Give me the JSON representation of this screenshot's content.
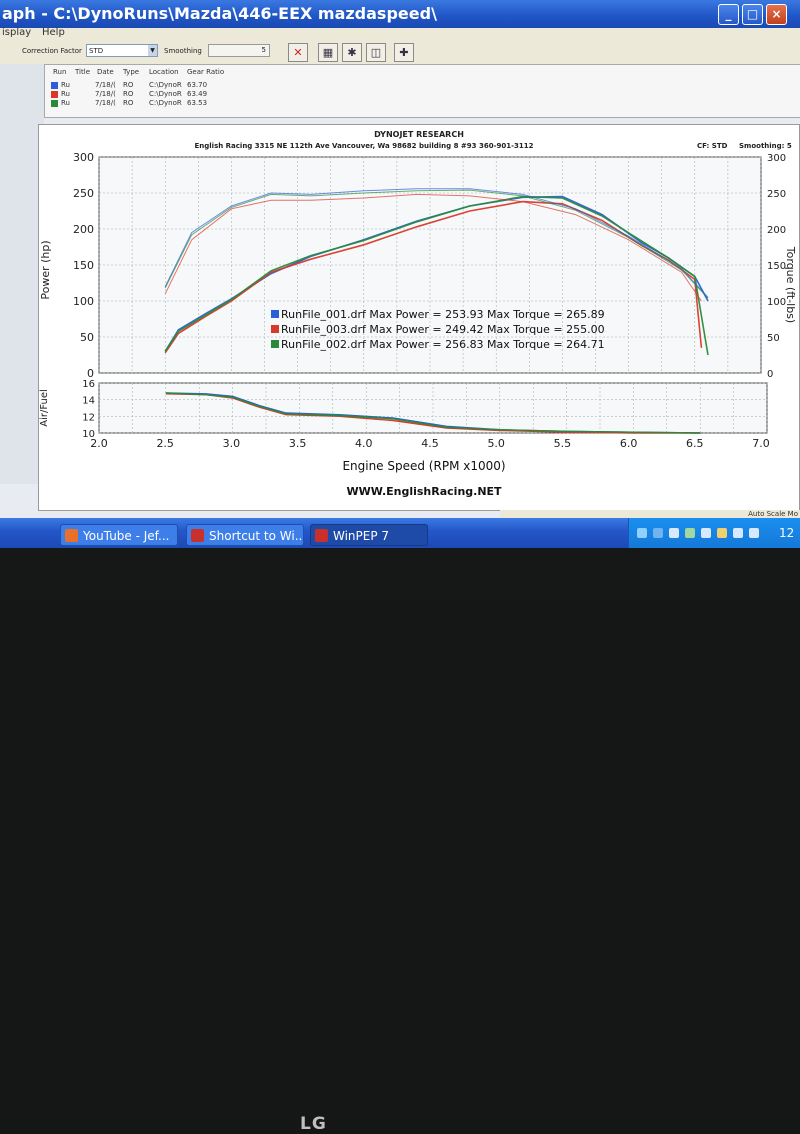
{
  "window": {
    "title": "aph - C:\\DynoRuns\\Mazda\\446-EEX mazdaspeed\\",
    "min_icon": "minimize-icon",
    "max_icon": "maximize-icon",
    "close_icon": "close-icon"
  },
  "menu": {
    "items": [
      "isplay",
      "Help"
    ]
  },
  "toolbar": {
    "correction_label": "Correction Factor",
    "correction_value": "STD",
    "smoothing_label": "Smoothing",
    "smoothing_value": "5",
    "icons": [
      "close-x-icon",
      "grid-icon",
      "settings-icon",
      "graph-icon",
      "crosshair-icon"
    ]
  },
  "run_list": {
    "columns": [
      "Run",
      "Title",
      "Date",
      "Type",
      "Location",
      "Gear Ratio"
    ],
    "rows": [
      {
        "color": "#2a5fd8",
        "run": "Ru",
        "date": "7/18/(",
        "type": "RO",
        "location": "C:\\DynoR",
        "gear_ratio": "63.70"
      },
      {
        "color": "#d83a2a",
        "run": "Ru",
        "date": "7/18/(",
        "type": "RO",
        "location": "C:\\DynoR",
        "gear_ratio": "63.49"
      },
      {
        "color": "#2a8a3a",
        "run": "Ru",
        "date": "7/18/(",
        "type": "RO",
        "location": "C:\\DynoR",
        "gear_ratio": "63.53"
      }
    ]
  },
  "graph": {
    "header_title": "DYNOJET RESEARCH",
    "header_sub": "English Racing 3315 NE 112th Ave Vancouver, Wa 98682 building 8 #93 360-901-3112",
    "cf_label": "CF: STD",
    "smoothing_label": "Smoothing: 5",
    "footer_url": "WWW.EnglishRacing.NET",
    "legend": [
      {
        "color": "#2a5fd8",
        "text": "RunFile_001.drf Max Power = 253.93 Max Torque = 265.89"
      },
      {
        "color": "#d83a2a",
        "text": "RunFile_003.drf Max Power = 249.42 Max Torque = 255.00"
      },
      {
        "color": "#2a8a3a",
        "text": "RunFile_002.drf Max Power = 256.83 Max Torque = 264.71"
      }
    ]
  },
  "chart_data": [
    {
      "type": "line",
      "title": "DYNOJET RESEARCH",
      "xlabel": "Engine Speed (RPM x1000)",
      "ylabel": "Power (hp)",
      "ylabel_right": "Torque (ft-lbs)",
      "xlim": [
        2.0,
        7.0
      ],
      "ylim": [
        0,
        300
      ],
      "x_ticks": [
        "2.0",
        "2.5",
        "3.0",
        "3.5",
        "4.0",
        "4.5",
        "5.0",
        "5.5",
        "6.0",
        "6.5",
        "7.0"
      ],
      "y_ticks": [
        "0",
        "50",
        "100",
        "150",
        "200",
        "250",
        "300"
      ],
      "y_right_ticks": [
        "0",
        "50",
        "100",
        "150",
        "200",
        "250",
        "300"
      ],
      "grid": true,
      "series": [
        {
          "name": "RunFile_001.drf",
          "kind": "power",
          "color": "#2a5fd8",
          "x": [
            2.5,
            2.6,
            2.8,
            3.0,
            3.3,
            3.6,
            4.0,
            4.4,
            4.8,
            5.2,
            5.5,
            5.8,
            6.1,
            6.3,
            6.5,
            6.6
          ],
          "y": [
            30,
            60,
            82,
            103,
            138,
            162,
            185,
            211,
            232,
            244,
            245,
            220,
            181,
            160,
            134,
            100
          ]
        },
        {
          "name": "RunFile_003.drf",
          "kind": "power",
          "color": "#d83a2a",
          "x": [
            2.5,
            2.6,
            2.8,
            3.0,
            3.3,
            3.6,
            4.0,
            4.4,
            4.8,
            5.2,
            5.5,
            5.8,
            6.1,
            6.3,
            6.5,
            6.55
          ],
          "y": [
            28,
            55,
            78,
            100,
            140,
            158,
            178,
            203,
            225,
            238,
            235,
            212,
            177,
            157,
            130,
            35
          ]
        },
        {
          "name": "RunFile_002.drf",
          "kind": "power",
          "color": "#2a8a3a",
          "x": [
            2.5,
            2.6,
            2.8,
            3.0,
            3.3,
            3.6,
            4.0,
            4.4,
            4.8,
            5.2,
            5.5,
            5.8,
            6.1,
            6.3,
            6.5,
            6.6
          ],
          "y": [
            30,
            58,
            80,
            102,
            142,
            163,
            184,
            210,
            232,
            245,
            243,
            218,
            183,
            160,
            134,
            25
          ]
        },
        {
          "name": "RunFile_001.drf",
          "kind": "torque",
          "color": "#2a5fd8",
          "x": [
            2.5,
            2.7,
            3.0,
            3.3,
            3.6,
            4.0,
            4.4,
            4.8,
            5.2,
            5.6,
            6.0,
            6.4,
            6.6
          ],
          "y": [
            120,
            195,
            232,
            250,
            248,
            253,
            256,
            256,
            248,
            228,
            190,
            145,
            105
          ]
        },
        {
          "name": "RunFile_003.drf",
          "kind": "torque",
          "color": "#d83a2a",
          "x": [
            2.5,
            2.7,
            3.0,
            3.3,
            3.6,
            4.0,
            4.4,
            4.8,
            5.2,
            5.6,
            6.0,
            6.4,
            6.55
          ],
          "y": [
            110,
            185,
            228,
            240,
            240,
            243,
            248,
            246,
            238,
            220,
            185,
            140,
            100
          ]
        },
        {
          "name": "RunFile_002.drf",
          "kind": "torque",
          "color": "#2a8a3a",
          "x": [
            2.5,
            2.7,
            3.0,
            3.3,
            3.6,
            4.0,
            4.4,
            4.8,
            5.2,
            5.6,
            6.0,
            6.4,
            6.6
          ],
          "y": [
            118,
            192,
            230,
            248,
            246,
            250,
            253,
            254,
            246,
            226,
            188,
            143,
            104
          ]
        }
      ]
    },
    {
      "type": "line",
      "ylabel": "Air/Fuel",
      "xlim": [
        2.0,
        7.0
      ],
      "ylim": [
        10,
        16
      ],
      "y_ticks": [
        "10",
        "12",
        "14",
        "16"
      ],
      "grid": true,
      "series": [
        {
          "name": "RunFile_001.drf",
          "color": "#2a5fd8",
          "x": [
            2.5,
            2.8,
            3.0,
            3.2,
            3.4,
            3.8,
            4.2,
            4.6,
            5.0,
            5.5,
            6.0,
            6.5
          ],
          "y": [
            14.8,
            14.7,
            14.4,
            13.3,
            12.4,
            12.2,
            11.8,
            10.8,
            10.4,
            10.2,
            10.1,
            10.0
          ]
        },
        {
          "name": "RunFile_003.drf",
          "color": "#d83a2a",
          "x": [
            2.5,
            2.8,
            3.0,
            3.2,
            3.4,
            3.8,
            4.2,
            4.6,
            5.0,
            5.5,
            6.0,
            6.5
          ],
          "y": [
            14.7,
            14.6,
            14.2,
            13.1,
            12.2,
            12.0,
            11.5,
            10.6,
            10.3,
            10.1,
            10.0,
            10.0
          ]
        },
        {
          "name": "RunFile_002.drf",
          "color": "#2a8a3a",
          "x": [
            2.5,
            2.8,
            3.0,
            3.2,
            3.4,
            3.8,
            4.2,
            4.6,
            5.0,
            5.5,
            6.0,
            6.5
          ],
          "y": [
            14.8,
            14.6,
            14.3,
            13.2,
            12.3,
            12.1,
            11.7,
            10.7,
            10.4,
            10.2,
            10.1,
            10.0
          ]
        }
      ]
    }
  ],
  "statusbar": {
    "text": "Auto Scale Mo"
  },
  "taskbar": {
    "buttons": [
      {
        "label": "YouTube - Jef...",
        "icon": "firefox-icon",
        "color": "#e8702a"
      },
      {
        "label": "Shortcut to Wi...",
        "icon": "shortcut-icon",
        "color": "#c9302c"
      },
      {
        "label": "WinPEP 7",
        "icon": "winpep-icon",
        "color": "#c9302c"
      }
    ],
    "clock": "12"
  },
  "bezel": {
    "brand": "LG"
  }
}
